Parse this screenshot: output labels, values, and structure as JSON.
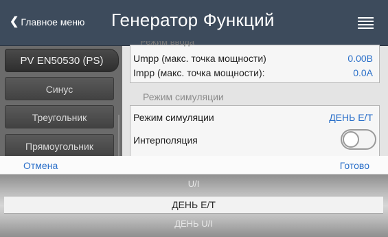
{
  "header": {
    "back_label": "Главное меню",
    "title": "Генератор Функций",
    "menu_icon": "hamburger-icon"
  },
  "sidebar": {
    "items": [
      {
        "label": "PV EN50530 (PS)",
        "active": true
      },
      {
        "label": "Синус",
        "active": false
      },
      {
        "label": "Треугольник",
        "active": false
      },
      {
        "label": "Прямоугольник",
        "active": false
      }
    ]
  },
  "content": {
    "cut_label": "Режим ввода",
    "rows": [
      {
        "label": "Umpp (макс. точка мощности)",
        "value": "0.00В"
      },
      {
        "label": "Impp (макс. точка мощности):",
        "value": "0.0A"
      }
    ],
    "section_title": "Режим симуляции",
    "simulation_mode": {
      "label": "Режим симуляции",
      "value": "ДЕНЬ E/T"
    },
    "interpolation": {
      "label": "Интерполяция",
      "enabled": false
    }
  },
  "picker": {
    "cancel_label": "Отмена",
    "done_label": "Готово",
    "options": [
      "U/I",
      "ДЕНЬ E/T",
      "ДЕНЬ U/I"
    ],
    "selected": "ДЕНЬ E/T"
  },
  "colors": {
    "header_bg": "#3d4b5c",
    "accent_blue": "#2a6fc9"
  }
}
